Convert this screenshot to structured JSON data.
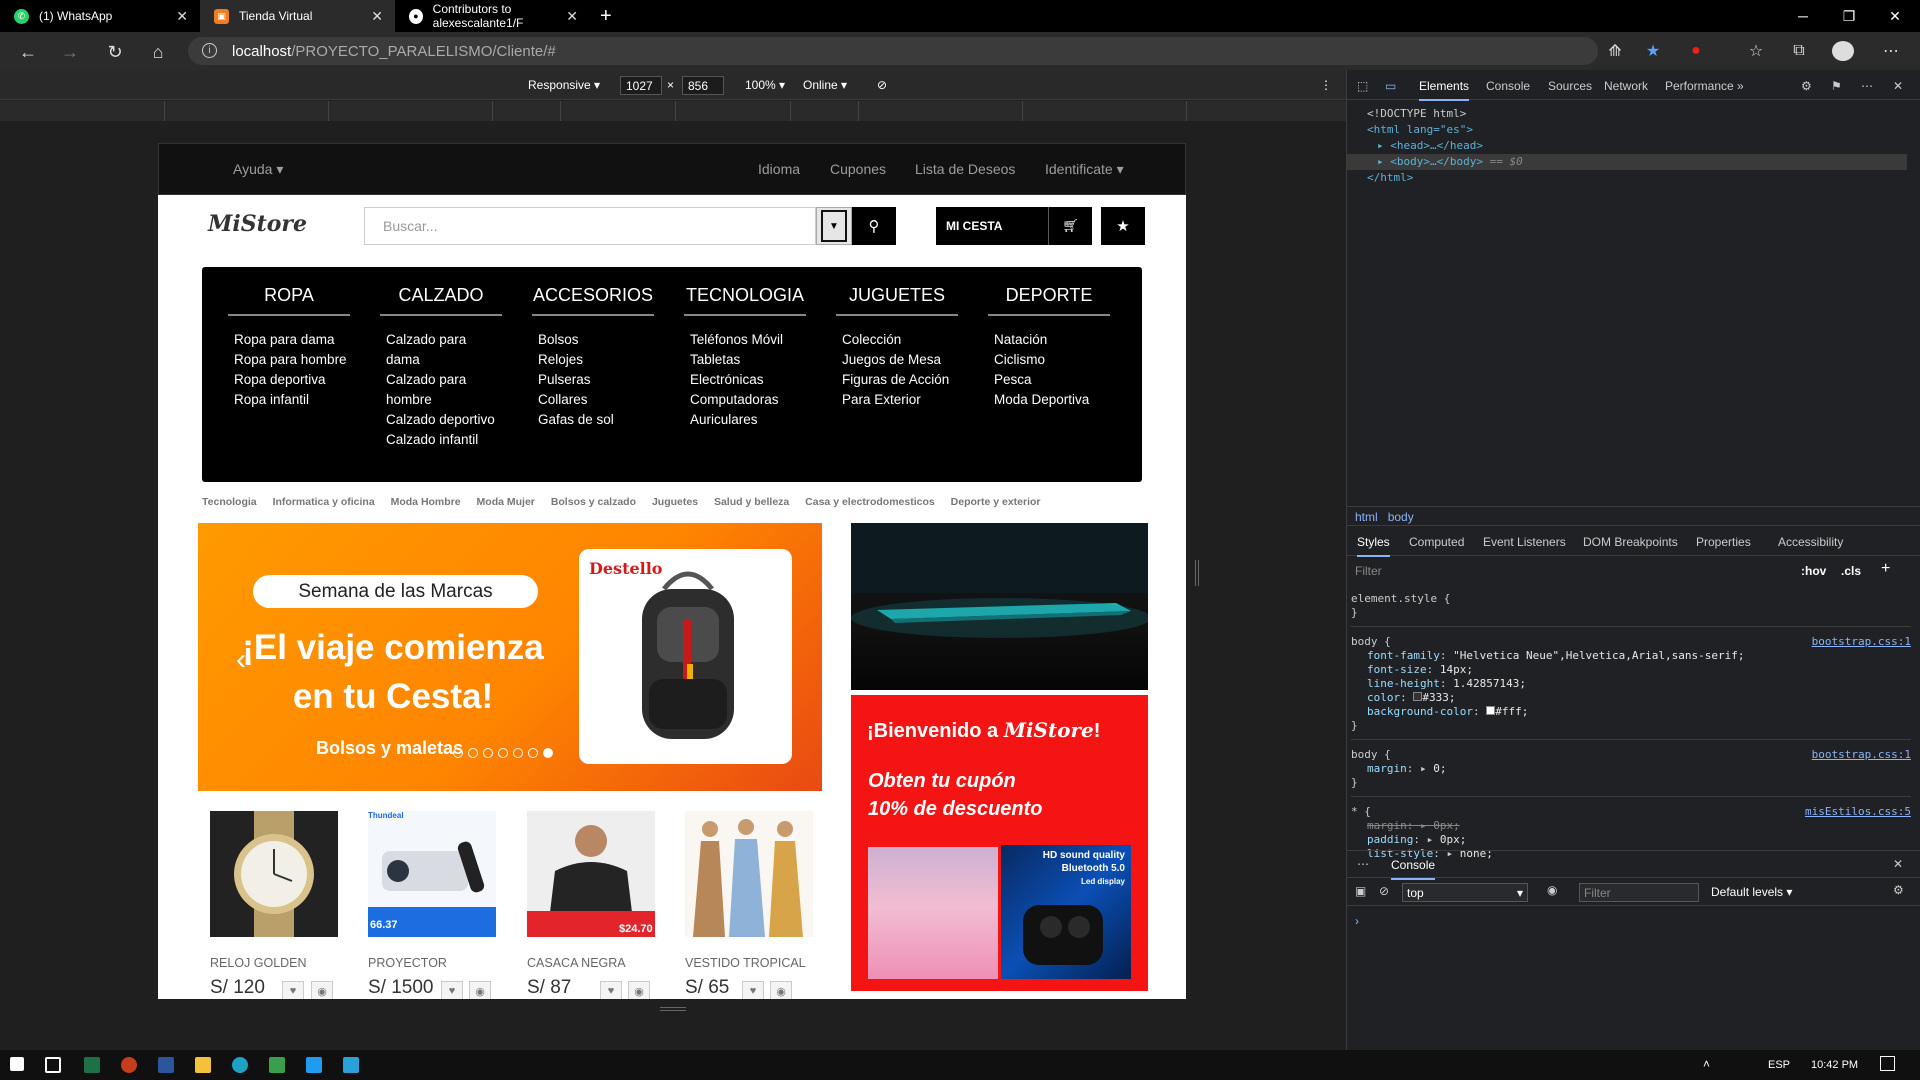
{
  "browser": {
    "tabs": [
      {
        "title": "(1) WhatsApp"
      },
      {
        "title": "Tienda Virtual"
      },
      {
        "title": "Contributors to alexescalante1/F"
      }
    ],
    "url_host": "localhost",
    "url_path": "/PROYECTO_PARALELISMO/Cliente/#"
  },
  "device_toolbar": {
    "mode": "Responsive",
    "width": "1027",
    "height": "856",
    "zoom": "100%",
    "network": "Online"
  },
  "site": {
    "topnav": {
      "help": "Ayuda",
      "language": "Idioma",
      "coupons": "Cupones",
      "wishlist": "Lista de Deseos",
      "login": "Identificate"
    },
    "brand": "MiStore",
    "search_placeholder": "Buscar...",
    "cart_label": "MI CESTA",
    "mega_menu": [
      {
        "title": "ROPA",
        "items": [
          "Ropa para dama",
          "Ropa para hombre",
          "Ropa deportiva",
          "Ropa infantil"
        ]
      },
      {
        "title": "CALZADO",
        "items": [
          "Calzado para dama",
          "Calzado para hombre",
          "Calzado deportivo",
          "Calzado infantil"
        ]
      },
      {
        "title": "ACCESORIOS",
        "items": [
          "Bolsos",
          "Relojes",
          "Pulseras",
          "Collares",
          "Gafas de sol"
        ]
      },
      {
        "title": "TECNOLOGIA",
        "items": [
          "Teléfonos Móvil",
          "Tabletas",
          "Electrónicas",
          "Computadoras",
          "Auriculares"
        ]
      },
      {
        "title": "JUGUETES",
        "items": [
          "Colección",
          "Juegos de Mesa",
          "Figuras de Acción",
          "Para Exterior"
        ]
      },
      {
        "title": "DEPORTE",
        "items": [
          "Natación",
          "Ciclismo",
          "Pesca",
          "Moda Deportiva"
        ]
      }
    ],
    "category_links": [
      "Tecnologia",
      "Informatica y oficina",
      "Moda Hombre",
      "Moda Mujer",
      "Bolsos y calzado",
      "Juguetes",
      "Salud y belleza",
      "Casa y electrodomesticos",
      "Deporte y exterior"
    ],
    "banner": {
      "pill": "Semana de las Marcas",
      "headline_1": "¡El viaje comienza",
      "headline_2": "en tu Cesta!",
      "subtitle": "Bolsos y maletas",
      "card_label": "Destello",
      "slides_total": 7,
      "active_slide": 7
    },
    "promo": {
      "title_prefix": "¡Bienvenido a",
      "title_brand": "MiStore",
      "title_suffix": "!",
      "line1": "Obten tu cupón",
      "line2": "10% de descuento",
      "earbuds_text_1": "HD sound quality",
      "earbuds_text_2": "Bluetooth 5.0",
      "earbuds_text_3": "Led display"
    },
    "products": [
      {
        "name": "RELOJ GOLDEN",
        "price": "S/ 120"
      },
      {
        "name": "PROYECTOR",
        "price": "S/ 1500"
      },
      {
        "name": "CASACA NEGRA",
        "price": "S/ 87"
      },
      {
        "name": "VESTIDO TROPICAL",
        "price": "S/ 65"
      }
    ],
    "projector_brand": "Thundeal",
    "projector_price": "66.37",
    "jacket_price": "$24.70"
  },
  "devtools": {
    "tabs": [
      "Elements",
      "Console",
      "Sources",
      "Network",
      "Performance"
    ],
    "dom": {
      "doctype": "<!DOCTYPE html>",
      "html_open": "<html lang=\"es\">",
      "head": "<head>…</head>",
      "body": "<body>…</body>",
      "body_sel": "== $0",
      "html_close": "</html>"
    },
    "breadcrumbs": [
      "html",
      "body"
    ],
    "style_tabs": [
      "Styles",
      "Computed",
      "Event Listeners",
      "DOM Breakpoints",
      "Properties",
      "Accessibility"
    ],
    "filter_placeholder": "Filter",
    "hov": ":hov",
    "cls": ".cls",
    "styles": {
      "element_style": "element.style {",
      "rule1_selector": "body {",
      "rule1_source": "bootstrap.css:1",
      "rule1_props": [
        {
          "name": "font-family",
          "value": "\"Helvetica Neue\",Helvetica,Arial,sans-serif;"
        },
        {
          "name": "font-size",
          "value": "14px;"
        },
        {
          "name": "line-height",
          "value": "1.42857143;"
        },
        {
          "name": "color",
          "value": "#333;"
        },
        {
          "name": "background-color",
          "value": "#fff;"
        }
      ],
      "rule2_selector": "body {",
      "rule2_source": "bootstrap.css:1",
      "rule2_props": [
        {
          "name": "margin",
          "value": "0;"
        }
      ],
      "rule3_selector": "* {",
      "rule3_source": "misEstilos.css:5",
      "rule3_props": [
        {
          "name": "margin",
          "value": "0px;"
        },
        {
          "name": "padding",
          "value": "0px;"
        },
        {
          "name": "list-style",
          "value": "none;"
        }
      ]
    },
    "console": {
      "tab": "Console",
      "context": "top",
      "filter_placeholder": "Filter",
      "levels": "Default levels"
    }
  },
  "taskbar": {
    "language": "ESP",
    "time": "10:42 PM"
  }
}
